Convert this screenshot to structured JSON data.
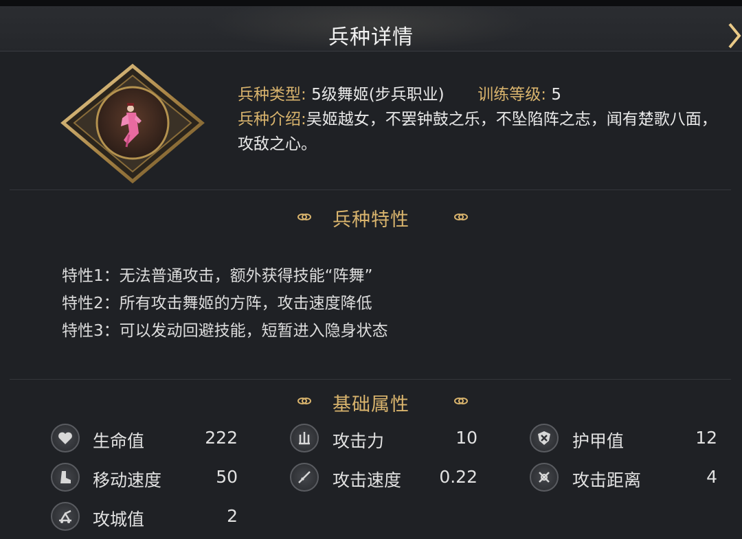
{
  "header": {
    "title": "兵种详情",
    "close_icon": "chevron-right-icon"
  },
  "unit": {
    "type_label": "兵种类型:",
    "type_value": "5级舞姬(步兵职业)",
    "training_label": "训练等级:",
    "training_value": "5",
    "intro_label": "兵种介绍:",
    "intro_value": "吴姬越女，不罢钟鼓之乐，不坠陷阵之志，闻有楚歌八面，攻敌之心。"
  },
  "traits_section": {
    "title": "兵种特性",
    "items": [
      "特性1：无法普通攻击，额外获得技能“阵舞”",
      "特性2：所有攻击舞姬的方阵，攻击速度降低",
      "特性3：可以发动回避技能，短暂进入隐身状态"
    ]
  },
  "attributes_section": {
    "title": "基础属性",
    "stats": [
      {
        "icon": "heart-icon",
        "label": "生命值",
        "value": "222"
      },
      {
        "icon": "attack-icon",
        "label": "攻击力",
        "value": "10"
      },
      {
        "icon": "armor-icon",
        "label": "护甲值",
        "value": "12"
      },
      {
        "icon": "boot-icon",
        "label": "移动速度",
        "value": "50"
      },
      {
        "icon": "sword-speed-icon",
        "label": "攻击速度",
        "value": "0.22"
      },
      {
        "icon": "range-icon",
        "label": "攻击距离",
        "value": "4"
      },
      {
        "icon": "siege-icon",
        "label": "攻城值",
        "value": "2"
      }
    ]
  },
  "colors": {
    "accent": "#d9b46d",
    "background": "#1f2125",
    "text": "#e8e8e8"
  }
}
